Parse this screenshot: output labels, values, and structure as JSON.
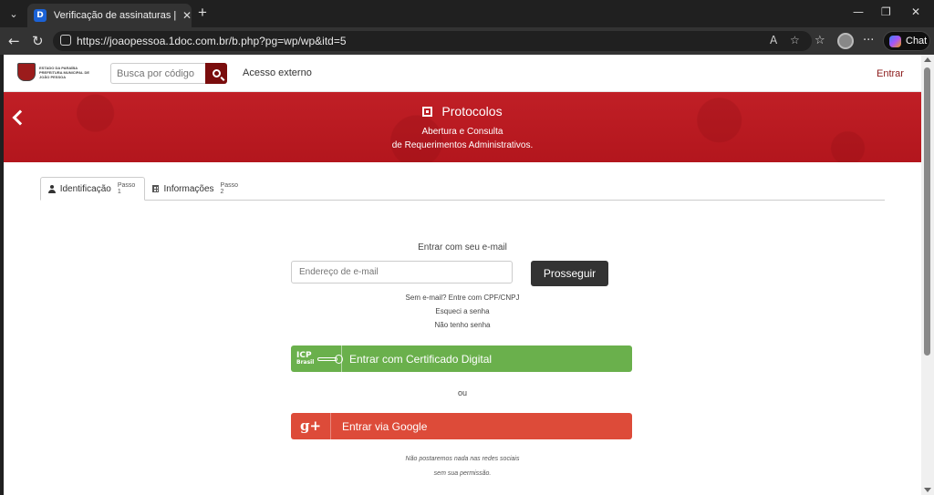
{
  "browser": {
    "tab_title": "Verificação de assinaturas | Central",
    "favicon_letter": "D",
    "url": "https://joaopessoa.1doc.com.br/b.php?pg=wp/wp&itd=5",
    "chat_label": "Chat"
  },
  "header": {
    "logo_text": "ESTADO DA PARAÍBA PREFEITURA MUNICIPAL DE JOÃO PESSOA",
    "search_placeholder": "Busca por código",
    "external_access": "Acesso externo",
    "login": "Entrar"
  },
  "banner": {
    "title": "Protocolos",
    "subtitle_line1": "Abertura e Consulta",
    "subtitle_line2": "de Requerimentos Administrativos."
  },
  "steps": [
    {
      "label": "Identificação",
      "step": "Passo 1"
    },
    {
      "label": "Informações",
      "step": "Passo 2"
    }
  ],
  "form": {
    "email_label": "Entrar com seu e-mail",
    "email_placeholder": "Endereço de e-mail",
    "continue_button": "Prosseguir",
    "no_email": "Sem e-mail? Entre com CPF/CNPJ",
    "forgot_password": "Esqueci a senha",
    "no_password": "Não tenho senha",
    "icp_logo_line1": "ICP",
    "icp_logo_line2": "Brasil",
    "cert_button": "Entrar com Certificado Digital",
    "or": "ou",
    "google_icon_text": "g+",
    "google_button": "Entrar via Google",
    "note_line1": "Não postaremos nada nas redes sociais",
    "note_line2": "sem sua permissão."
  }
}
